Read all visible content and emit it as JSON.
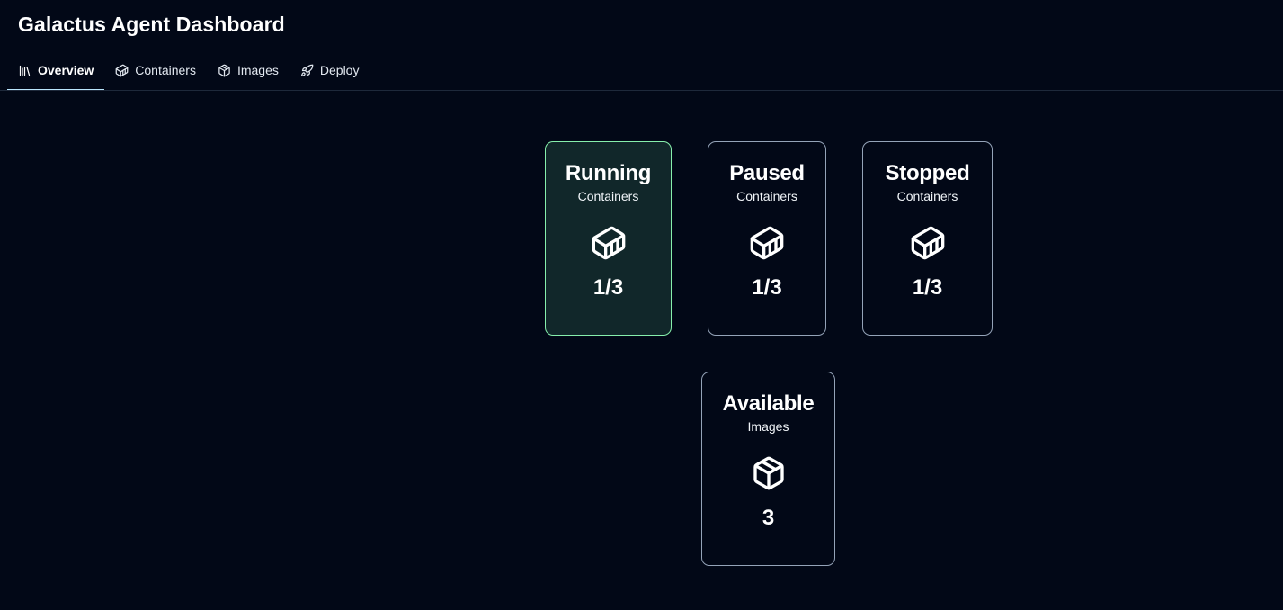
{
  "app": {
    "title": "Galactus Agent Dashboard"
  },
  "tabs": [
    {
      "label": "Overview",
      "icon": "library-icon",
      "active": true
    },
    {
      "label": "Containers",
      "icon": "container-icon",
      "active": false
    },
    {
      "label": "Images",
      "icon": "package-icon",
      "active": false
    },
    {
      "label": "Deploy",
      "icon": "rocket-icon",
      "active": false
    }
  ],
  "cards": {
    "running": {
      "title": "Running",
      "subtitle": "Containers",
      "icon": "container-icon",
      "value": "1/3"
    },
    "paused": {
      "title": "Paused",
      "subtitle": "Containers",
      "icon": "container-icon",
      "value": "1/3"
    },
    "stopped": {
      "title": "Stopped",
      "subtitle": "Containers",
      "icon": "container-icon",
      "value": "1/3"
    },
    "available": {
      "title": "Available",
      "subtitle": "Images",
      "icon": "package-icon",
      "value": "3"
    }
  },
  "colors": {
    "background": "#020817",
    "active_tab_underline": "#bae6fd",
    "highlight_card_bg": "#11272a",
    "highlight_card_border": "#86efac"
  }
}
